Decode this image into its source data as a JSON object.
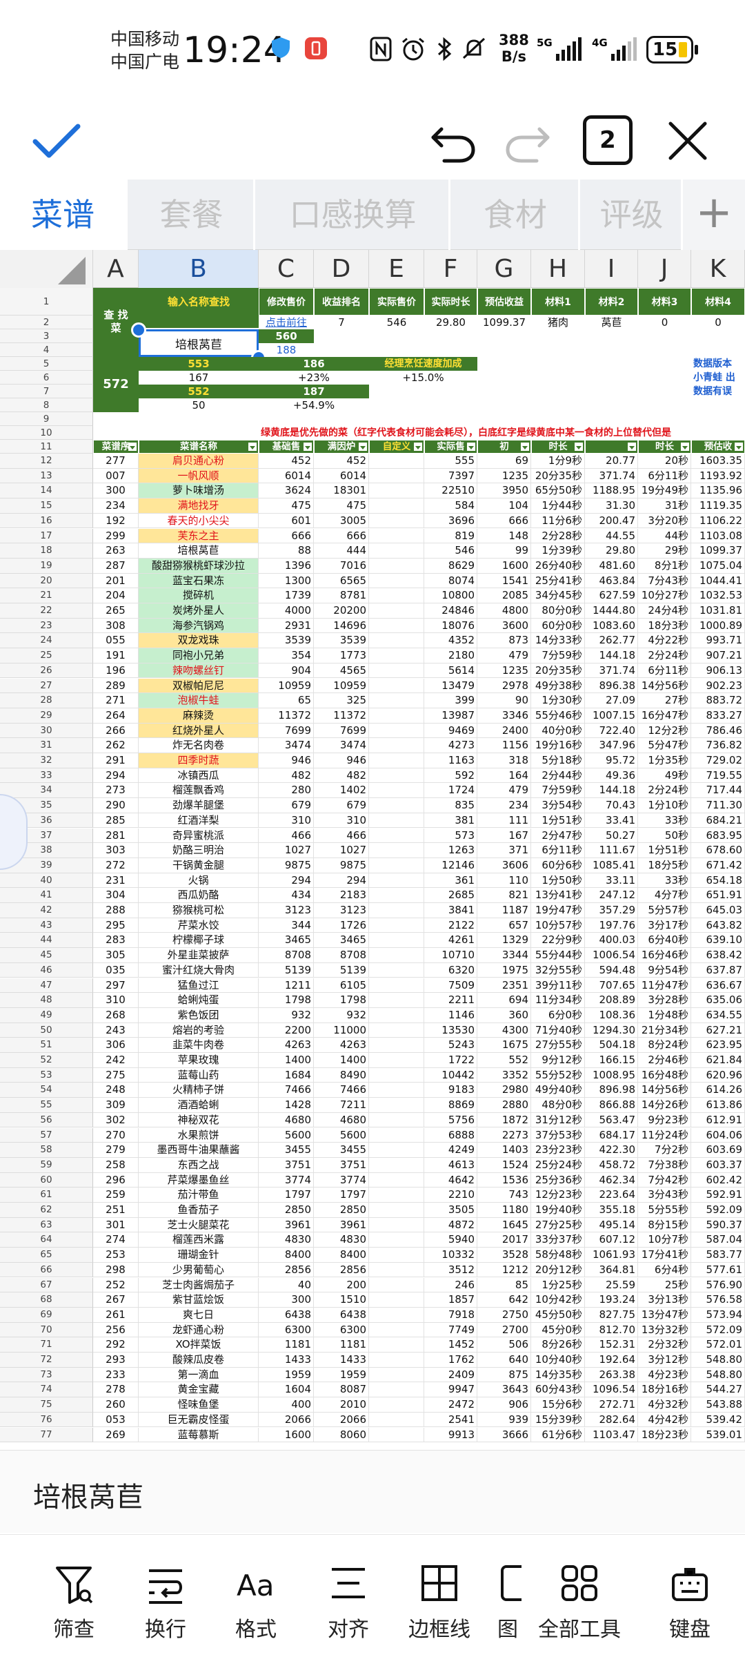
{
  "status": {
    "carrier1": "中国移动",
    "carrier2": "中国广电",
    "time": "19:24",
    "speed_top": "388",
    "speed_bottom": "B/s",
    "net1": "5G",
    "net2": "4G",
    "battery": "15"
  },
  "toolbar": {
    "confirm": "confirm",
    "undo": "undo",
    "redo": "redo",
    "count": "2",
    "close": "close"
  },
  "tabs": [
    "菜谱",
    "套餐",
    "口感换算",
    "食材",
    "评级"
  ],
  "columns": [
    "A",
    "B",
    "C",
    "D",
    "E",
    "F",
    "G",
    "H",
    "I",
    "J",
    "K"
  ],
  "header": {
    "r1_left": "查 找\n菜",
    "r1_b": "输入名称查找",
    "c1": "修改售价",
    "d1": "收益排名",
    "e1": "实际售价",
    "f1": "实际时长",
    "g1": "预估收益",
    "h1": "材料1",
    "i1": "材料2",
    "j1": "材料3",
    "k1": "材料4",
    "c2": "点击前往",
    "d2": "7",
    "e2": "546",
    "f2": "29.80",
    "g2": "1099.37",
    "h2": "猪肉",
    "i2": "莴苣",
    "j2": "0",
    "k2": "0",
    "b4": "培根莴苣",
    "c3": "560",
    "c4": "188",
    "a5": "572",
    "b5": "553",
    "c5": "186",
    "e5": "经理烹饪速度加成",
    "k5": "数据版本",
    "b6": "167",
    "c6": "+23%",
    "e6": "+15.0%",
    "k6": "小青蛙 出",
    "b7": "552",
    "c7": "187",
    "k7": "数据有误",
    "b8": "50",
    "c8": "+54.9%",
    "note10": "绿黄底是优先做的菜（红字代表食材可能会耗尽），白底红字是绿黄底中某一食材的上位替代但是",
    "h11": [
      "菜谱序",
      "菜谱名称",
      "基础售",
      "满因炉",
      "自定义",
      "实际售",
      "初",
      "时长",
      "",
      "时长",
      "预估收"
    ]
  },
  "rows": [
    {
      "n": 12,
      "a": "277",
      "b": "肩贝通心粉",
      "c": "452",
      "d": "452",
      "f": "555",
      "g": "69",
      "h": "1分9秒",
      "i": "20.77",
      "j": "20秒",
      "k": "1603.35",
      "bg": "#ffe699",
      "red": true
    },
    {
      "n": 13,
      "a": "007",
      "b": "一帆风顺",
      "c": "6014",
      "d": "6014",
      "f": "7397",
      "g": "1235",
      "h": "20分35秒",
      "i": "371.74",
      "j": "6分11秒",
      "k": "1193.92",
      "bg": "#ffe699",
      "red": true
    },
    {
      "n": 14,
      "a": "300",
      "b": "萝卜味增汤",
      "c": "3624",
      "d": "18301",
      "f": "22510",
      "g": "3950",
      "h": "65分50秒",
      "i": "1188.95",
      "j": "19分49秒",
      "k": "1135.96",
      "bg": "#c6efce",
      "red": false
    },
    {
      "n": 15,
      "a": "234",
      "b": "满地找牙",
      "c": "475",
      "d": "475",
      "f": "584",
      "g": "104",
      "h": "1分44秒",
      "i": "31.30",
      "j": "31秒",
      "k": "1119.35",
      "bg": "#ffe699",
      "red": true
    },
    {
      "n": 16,
      "a": "192",
      "b": "春天的小尖尖",
      "c": "601",
      "d": "3005",
      "f": "3696",
      "g": "666",
      "h": "11分6秒",
      "i": "200.47",
      "j": "3分20秒",
      "k": "1106.22",
      "bg": "#ffffff",
      "red": true
    },
    {
      "n": 17,
      "a": "299",
      "b": "芙东之主",
      "c": "666",
      "d": "666",
      "f": "819",
      "g": "148",
      "h": "2分28秒",
      "i": "44.55",
      "j": "44秒",
      "k": "1103.08",
      "bg": "#ffe699",
      "red": true
    },
    {
      "n": 18,
      "a": "263",
      "b": "培根莴苣",
      "c": "88",
      "d": "444",
      "f": "546",
      "g": "99",
      "h": "1分39秒",
      "i": "29.80",
      "j": "29秒",
      "k": "1099.37",
      "bg": "#ffffff",
      "red": false
    },
    {
      "n": 19,
      "a": "287",
      "b": "酸甜猕猴桃虾球沙拉",
      "c": "1396",
      "d": "7016",
      "f": "8629",
      "g": "1600",
      "h": "26分40秒",
      "i": "481.60",
      "j": "8分1秒",
      "k": "1075.04",
      "bg": "#c6efce",
      "red": false
    },
    {
      "n": 20,
      "a": "201",
      "b": "蓝宝石果冻",
      "c": "1300",
      "d": "6565",
      "f": "8074",
      "g": "1541",
      "h": "25分41秒",
      "i": "463.84",
      "j": "7分43秒",
      "k": "1044.41",
      "bg": "#c6efce",
      "red": false
    },
    {
      "n": 21,
      "a": "204",
      "b": "搅碎机",
      "c": "1739",
      "d": "8781",
      "f": "10800",
      "g": "2085",
      "h": "34分45秒",
      "i": "627.59",
      "j": "10分27秒",
      "k": "1032.53",
      "bg": "#c6efce",
      "red": false
    },
    {
      "n": 22,
      "a": "265",
      "b": "炭烤外星人",
      "c": "4000",
      "d": "20200",
      "f": "24846",
      "g": "4800",
      "h": "80分0秒",
      "i": "1444.80",
      "j": "24分4秒",
      "k": "1031.81",
      "bg": "#c6efce",
      "red": false
    },
    {
      "n": 23,
      "a": "308",
      "b": "海参汽锅鸡",
      "c": "2931",
      "d": "14696",
      "f": "18076",
      "g": "3600",
      "h": "60分0秒",
      "i": "1083.60",
      "j": "18分3秒",
      "k": "1000.89",
      "bg": "#c6efce",
      "red": false
    },
    {
      "n": 24,
      "a": "055",
      "b": "双龙戏珠",
      "c": "3539",
      "d": "3539",
      "f": "4352",
      "g": "873",
      "h": "14分33秒",
      "i": "262.77",
      "j": "4分22秒",
      "k": "993.71",
      "bg": "#ffe699",
      "red": false
    },
    {
      "n": 25,
      "a": "191",
      "b": "同袍小兄弟",
      "c": "354",
      "d": "1773",
      "f": "2180",
      "g": "479",
      "h": "7分59秒",
      "i": "144.18",
      "j": "2分24秒",
      "k": "907.21",
      "bg": "#c6efce",
      "red": false
    },
    {
      "n": 26,
      "a": "196",
      "b": "辣吻螺丝钉",
      "c": "904",
      "d": "4565",
      "f": "5614",
      "g": "1235",
      "h": "20分35秒",
      "i": "371.74",
      "j": "6分11秒",
      "k": "906.13",
      "bg": "#c6efce",
      "red": true
    },
    {
      "n": 27,
      "a": "289",
      "b": "双椒帕尼尼",
      "c": "10959",
      "d": "10959",
      "f": "13479",
      "g": "2978",
      "h": "49分38秒",
      "i": "896.38",
      "j": "14分56秒",
      "k": "902.23",
      "bg": "#ffe699",
      "red": false
    },
    {
      "n": 28,
      "a": "271",
      "b": "泡椒牛蛙",
      "c": "65",
      "d": "325",
      "f": "399",
      "g": "90",
      "h": "1分30秒",
      "i": "27.09",
      "j": "27秒",
      "k": "883.72",
      "bg": "#c6efce",
      "red": true
    },
    {
      "n": 29,
      "a": "264",
      "b": "麻辣烫",
      "c": "11372",
      "d": "11372",
      "f": "13987",
      "g": "3346",
      "h": "55分46秒",
      "i": "1007.15",
      "j": "16分47秒",
      "k": "833.27",
      "bg": "#ffe699",
      "red": false
    },
    {
      "n": 30,
      "a": "266",
      "b": "红烧外星人",
      "c": "7699",
      "d": "7699",
      "f": "9469",
      "g": "2400",
      "h": "40分0秒",
      "i": "722.40",
      "j": "12分2秒",
      "k": "786.46",
      "bg": "#ffe699",
      "red": false
    },
    {
      "n": 31,
      "a": "262",
      "b": "炸无名肉卷",
      "c": "3474",
      "d": "3474",
      "f": "4273",
      "g": "1156",
      "h": "19分16秒",
      "i": "347.96",
      "j": "5分47秒",
      "k": "736.82",
      "bg": "#ffffff",
      "red": false
    },
    {
      "n": 32,
      "a": "291",
      "b": "四季时蔬",
      "c": "946",
      "d": "946",
      "f": "1163",
      "g": "318",
      "h": "5分18秒",
      "i": "95.72",
      "j": "1分35秒",
      "k": "729.02",
      "bg": "#ffe699",
      "red": true
    },
    {
      "n": 33,
      "a": "294",
      "b": "冰镇西瓜",
      "c": "482",
      "d": "482",
      "f": "592",
      "g": "164",
      "h": "2分44秒",
      "i": "49.36",
      "j": "49秒",
      "k": "719.55",
      "bg": "#ffffff",
      "red": false
    },
    {
      "n": 34,
      "a": "273",
      "b": "榴莲飘香鸡",
      "c": "280",
      "d": "1402",
      "f": "1724",
      "g": "479",
      "h": "7分59秒",
      "i": "144.18",
      "j": "2分24秒",
      "k": "717.44",
      "bg": "#ffffff",
      "red": false
    },
    {
      "n": 35,
      "a": "290",
      "b": "劲爆羊腿堡",
      "c": "679",
      "d": "679",
      "f": "835",
      "g": "234",
      "h": "3分54秒",
      "i": "70.43",
      "j": "1分10秒",
      "k": "711.30",
      "bg": "#ffffff",
      "red": false
    },
    {
      "n": 36,
      "a": "285",
      "b": "红酒洋梨",
      "c": "310",
      "d": "310",
      "f": "381",
      "g": "111",
      "h": "1分51秒",
      "i": "33.41",
      "j": "33秒",
      "k": "684.21",
      "bg": "#ffffff",
      "red": false
    },
    {
      "n": 37,
      "a": "281",
      "b": "奇异蜜桃派",
      "c": "466",
      "d": "466",
      "f": "573",
      "g": "167",
      "h": "2分47秒",
      "i": "50.27",
      "j": "50秒",
      "k": "683.95",
      "bg": "#ffffff",
      "red": false
    },
    {
      "n": 38,
      "a": "303",
      "b": "奶酪三明治",
      "c": "1027",
      "d": "1027",
      "f": "1263",
      "g": "371",
      "h": "6分11秒",
      "i": "111.67",
      "j": "1分51秒",
      "k": "678.60",
      "bg": "#ffffff",
      "red": false
    },
    {
      "n": 39,
      "a": "272",
      "b": "干锅黄金腿",
      "c": "9875",
      "d": "9875",
      "f": "12146",
      "g": "3606",
      "h": "60分6秒",
      "i": "1085.41",
      "j": "18分5秒",
      "k": "671.42",
      "bg": "#ffffff",
      "red": false
    },
    {
      "n": 40,
      "a": "231",
      "b": "火锅",
      "c": "294",
      "d": "294",
      "f": "361",
      "g": "110",
      "h": "1分50秒",
      "i": "33.11",
      "j": "33秒",
      "k": "654.18",
      "bg": "#ffffff",
      "red": false
    },
    {
      "n": 41,
      "a": "304",
      "b": "西瓜奶酪",
      "c": "434",
      "d": "2183",
      "f": "2685",
      "g": "821",
      "h": "13分41秒",
      "i": "247.12",
      "j": "4分7秒",
      "k": "651.91",
      "bg": "#ffffff",
      "red": false
    },
    {
      "n": 42,
      "a": "288",
      "b": "猕猴桃可松",
      "c": "3123",
      "d": "3123",
      "f": "3841",
      "g": "1187",
      "h": "19分47秒",
      "i": "357.29",
      "j": "5分57秒",
      "k": "645.03",
      "bg": "#ffffff",
      "red": false
    },
    {
      "n": 43,
      "a": "295",
      "b": "芹菜水饺",
      "c": "344",
      "d": "1726",
      "f": "2122",
      "g": "657",
      "h": "10分57秒",
      "i": "197.76",
      "j": "3分17秒",
      "k": "643.82",
      "bg": "#ffffff",
      "red": false
    },
    {
      "n": 44,
      "a": "283",
      "b": "柠檬椰子球",
      "c": "3465",
      "d": "3465",
      "f": "4261",
      "g": "1329",
      "h": "22分9秒",
      "i": "400.03",
      "j": "6分40秒",
      "k": "639.10",
      "bg": "#ffffff",
      "red": false
    },
    {
      "n": 45,
      "a": "305",
      "b": "外星韭菜披萨",
      "c": "8708",
      "d": "8708",
      "f": "10710",
      "g": "3344",
      "h": "55分44秒",
      "i": "1006.54",
      "j": "16分46秒",
      "k": "638.42",
      "bg": "#ffffff",
      "red": false
    },
    {
      "n": 46,
      "a": "035",
      "b": "蜜汁红烧大骨肉",
      "c": "5139",
      "d": "5139",
      "f": "6320",
      "g": "1975",
      "h": "32分55秒",
      "i": "594.48",
      "j": "9分54秒",
      "k": "637.87",
      "bg": "#ffffff",
      "red": false
    },
    {
      "n": 47,
      "a": "297",
      "b": "猛鱼过江",
      "c": "1211",
      "d": "6105",
      "f": "7509",
      "g": "2351",
      "h": "39分11秒",
      "i": "707.65",
      "j": "11分47秒",
      "k": "636.67",
      "bg": "#ffffff",
      "red": false
    },
    {
      "n": 48,
      "a": "310",
      "b": "蛤蜊炖蛋",
      "c": "1798",
      "d": "1798",
      "f": "2211",
      "g": "694",
      "h": "11分34秒",
      "i": "208.89",
      "j": "3分28秒",
      "k": "635.06",
      "bg": "#ffffff",
      "red": false
    },
    {
      "n": 49,
      "a": "268",
      "b": "紫色饭团",
      "c": "932",
      "d": "932",
      "f": "1146",
      "g": "360",
      "h": "6分0秒",
      "i": "108.36",
      "j": "1分48秒",
      "k": "634.55",
      "bg": "#ffffff",
      "red": false
    },
    {
      "n": 50,
      "a": "243",
      "b": "熔岩的考验",
      "c": "2200",
      "d": "11000",
      "f": "13530",
      "g": "4300",
      "h": "71分40秒",
      "i": "1294.30",
      "j": "21分34秒",
      "k": "627.21",
      "bg": "#ffffff",
      "red": false
    },
    {
      "n": 51,
      "a": "306",
      "b": "韭菜牛肉卷",
      "c": "4263",
      "d": "4263",
      "f": "5243",
      "g": "1675",
      "h": "27分55秒",
      "i": "504.18",
      "j": "8分24秒",
      "k": "623.95",
      "bg": "#ffffff",
      "red": false
    },
    {
      "n": 52,
      "a": "242",
      "b": "苹果玫瑰",
      "c": "1400",
      "d": "1400",
      "f": "1722",
      "g": "552",
      "h": "9分12秒",
      "i": "166.15",
      "j": "2分46秒",
      "k": "621.84",
      "bg": "#ffffff",
      "red": false
    },
    {
      "n": 53,
      "a": "275",
      "b": "蓝莓山药",
      "c": "1684",
      "d": "8490",
      "f": "10442",
      "g": "3352",
      "h": "55分52秒",
      "i": "1008.95",
      "j": "16分48秒",
      "k": "620.96",
      "bg": "#ffffff",
      "red": false
    },
    {
      "n": 54,
      "a": "248",
      "b": "火精柿子饼",
      "c": "7466",
      "d": "7466",
      "f": "9183",
      "g": "2980",
      "h": "49分40秒",
      "i": "896.98",
      "j": "14分56秒",
      "k": "614.26",
      "bg": "#ffffff",
      "red": false
    },
    {
      "n": 55,
      "a": "309",
      "b": "酒酒蛤蜊",
      "c": "1428",
      "d": "7211",
      "f": "8869",
      "g": "2880",
      "h": "48分0秒",
      "i": "866.88",
      "j": "14分26秒",
      "k": "613.86",
      "bg": "#ffffff",
      "red": false
    },
    {
      "n": 56,
      "a": "302",
      "b": "神秘双花",
      "c": "4680",
      "d": "4680",
      "f": "5756",
      "g": "1872",
      "h": "31分12秒",
      "i": "563.47",
      "j": "9分23秒",
      "k": "612.91",
      "bg": "#ffffff",
      "red": false
    },
    {
      "n": 57,
      "a": "270",
      "b": "水果煎饼",
      "c": "5600",
      "d": "5600",
      "f": "6888",
      "g": "2273",
      "h": "37分53秒",
      "i": "684.17",
      "j": "11分24秒",
      "k": "604.06",
      "bg": "#ffffff",
      "red": false
    },
    {
      "n": 58,
      "a": "279",
      "b": "墨西哥牛油果蘸酱",
      "c": "3455",
      "d": "3455",
      "f": "4249",
      "g": "1403",
      "h": "23分23秒",
      "i": "422.30",
      "j": "7分2秒",
      "k": "603.69",
      "bg": "#ffffff",
      "red": false
    },
    {
      "n": 59,
      "a": "258",
      "b": "东西之战",
      "c": "3751",
      "d": "3751",
      "f": "4613",
      "g": "1524",
      "h": "25分24秒",
      "i": "458.72",
      "j": "7分38秒",
      "k": "603.37",
      "bg": "#ffffff",
      "red": false
    },
    {
      "n": 60,
      "a": "296",
      "b": "芹菜爆墨鱼丝",
      "c": "3774",
      "d": "3774",
      "f": "4642",
      "g": "1536",
      "h": "25分36秒",
      "i": "462.34",
      "j": "7分42秒",
      "k": "602.42",
      "bg": "#ffffff",
      "red": false
    },
    {
      "n": 61,
      "a": "259",
      "b": "茄汁带鱼",
      "c": "1797",
      "d": "1797",
      "f": "2210",
      "g": "743",
      "h": "12分23秒",
      "i": "223.64",
      "j": "3分43秒",
      "k": "592.91",
      "bg": "#ffffff",
      "red": false
    },
    {
      "n": 62,
      "a": "251",
      "b": "鱼香茄子",
      "c": "2850",
      "d": "2850",
      "f": "3505",
      "g": "1180",
      "h": "19分40秒",
      "i": "355.18",
      "j": "5分55秒",
      "k": "592.09",
      "bg": "#ffffff",
      "red": false
    },
    {
      "n": 63,
      "a": "301",
      "b": "芝士火腿菜花",
      "c": "3961",
      "d": "3961",
      "f": "4872",
      "g": "1645",
      "h": "27分25秒",
      "i": "495.14",
      "j": "8分15秒",
      "k": "590.37",
      "bg": "#ffffff",
      "red": false
    },
    {
      "n": 64,
      "a": "274",
      "b": "榴莲西米露",
      "c": "4830",
      "d": "4830",
      "f": "5940",
      "g": "2017",
      "h": "33分37秒",
      "i": "607.12",
      "j": "10分7秒",
      "k": "587.04",
      "bg": "#ffffff",
      "red": false
    },
    {
      "n": 65,
      "a": "253",
      "b": "珊瑚金针",
      "c": "8400",
      "d": "8400",
      "f": "10332",
      "g": "3528",
      "h": "58分48秒",
      "i": "1061.93",
      "j": "17分41秒",
      "k": "583.77",
      "bg": "#ffffff",
      "red": false
    },
    {
      "n": 66,
      "a": "298",
      "b": "少男葡萄心",
      "c": "2856",
      "d": "2856",
      "f": "3512",
      "g": "1212",
      "h": "20分12秒",
      "i": "364.81",
      "j": "6分4秒",
      "k": "577.61",
      "bg": "#ffffff",
      "red": false
    },
    {
      "n": 67,
      "a": "252",
      "b": "芝士肉酱焗茄子",
      "c": "40",
      "d": "200",
      "f": "246",
      "g": "85",
      "h": "1分25秒",
      "i": "25.59",
      "j": "25秒",
      "k": "576.90",
      "bg": "#ffffff",
      "red": false
    },
    {
      "n": 68,
      "a": "267",
      "b": "紫甘蓝烩饭",
      "c": "300",
      "d": "1510",
      "f": "1857",
      "g": "642",
      "h": "10分42秒",
      "i": "193.24",
      "j": "3分13秒",
      "k": "576.58",
      "bg": "#ffffff",
      "red": false
    },
    {
      "n": 69,
      "a": "261",
      "b": "爽七日",
      "c": "6438",
      "d": "6438",
      "f": "7918",
      "g": "2750",
      "h": "45分50秒",
      "i": "827.75",
      "j": "13分47秒",
      "k": "573.94",
      "bg": "#ffffff",
      "red": false
    },
    {
      "n": 70,
      "a": "256",
      "b": "龙虾通心粉",
      "c": "6300",
      "d": "6300",
      "f": "7749",
      "g": "2700",
      "h": "45分0秒",
      "i": "812.70",
      "j": "13分32秒",
      "k": "572.09",
      "bg": "#ffffff",
      "red": false
    },
    {
      "n": 71,
      "a": "292",
      "b": "XO拌菜饭",
      "c": "1181",
      "d": "1181",
      "f": "1452",
      "g": "506",
      "h": "8分26秒",
      "i": "152.31",
      "j": "2分32秒",
      "k": "572.01",
      "bg": "#ffffff",
      "red": false
    },
    {
      "n": 72,
      "a": "293",
      "b": "酸辣瓜皮卷",
      "c": "1433",
      "d": "1433",
      "f": "1762",
      "g": "640",
      "h": "10分40秒",
      "i": "192.64",
      "j": "3分12秒",
      "k": "548.80",
      "bg": "#ffffff",
      "red": false
    },
    {
      "n": 73,
      "a": "233",
      "b": "第一滴血",
      "c": "1959",
      "d": "1959",
      "f": "2409",
      "g": "875",
      "h": "14分35秒",
      "i": "263.38",
      "j": "4分23秒",
      "k": "548.80",
      "bg": "#ffffff",
      "red": false
    },
    {
      "n": 74,
      "a": "278",
      "b": "黄金宝藏",
      "c": "1604",
      "d": "8087",
      "f": "9947",
      "g": "3643",
      "h": "60分43秒",
      "i": "1096.54",
      "j": "18分16秒",
      "k": "544.27",
      "bg": "#ffffff",
      "red": false
    },
    {
      "n": 75,
      "a": "260",
      "b": "怪味鱼堡",
      "c": "400",
      "d": "2010",
      "f": "2472",
      "g": "906",
      "h": "15分6秒",
      "i": "272.71",
      "j": "4分32秒",
      "k": "543.88",
      "bg": "#ffffff",
      "red": false
    },
    {
      "n": 76,
      "a": "053",
      "b": "巨无霸皮怪蛋",
      "c": "2066",
      "d": "2066",
      "f": "2541",
      "g": "939",
      "h": "15分39秒",
      "i": "282.64",
      "j": "4分42秒",
      "k": "539.42",
      "bg": "#ffffff",
      "red": false
    },
    {
      "n": 77,
      "a": "269",
      "b": "蓝莓慕斯",
      "c": "1600",
      "d": "8060",
      "f": "9913",
      "g": "3666",
      "h": "61分6秒",
      "i": "1103.47",
      "j": "18分23秒",
      "k": "539.01",
      "bg": "#ffffff",
      "red": false
    }
  ],
  "formula_bar": {
    "value": "培根莴苣"
  },
  "bottom_tools": [
    "筛查",
    "换行",
    "格式",
    "对齐",
    "边框线",
    "图",
    "全部工具",
    "键盘"
  ]
}
